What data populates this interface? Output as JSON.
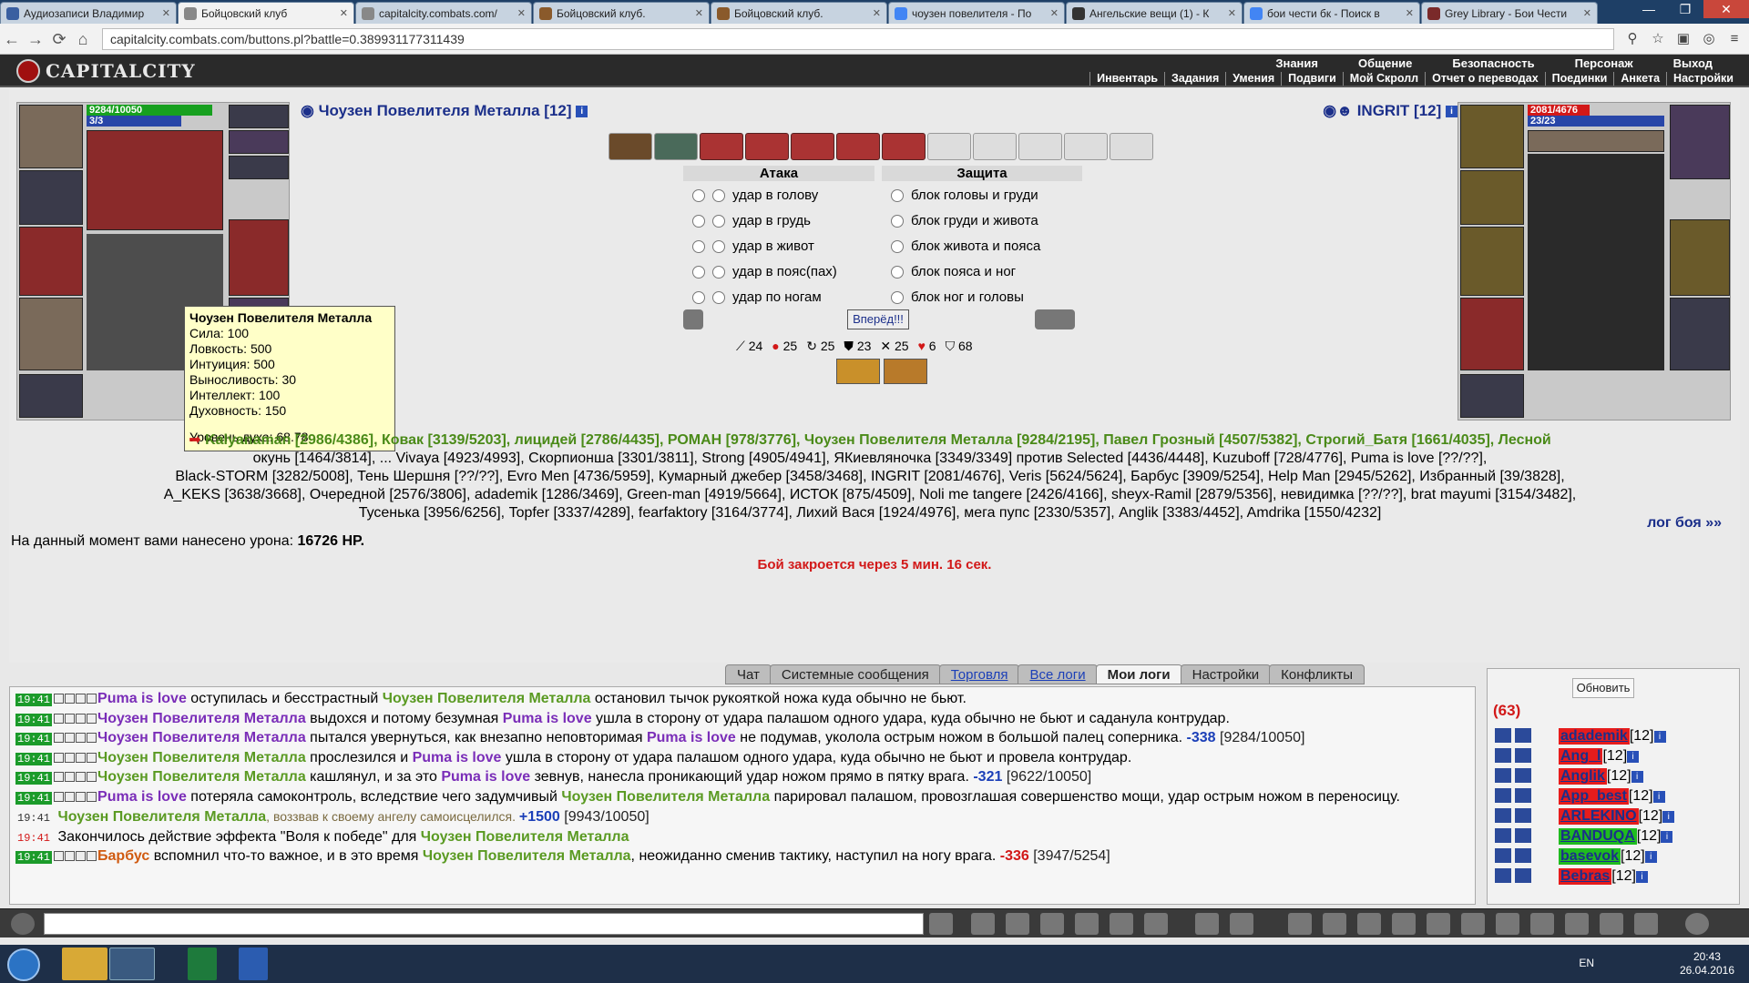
{
  "browser": {
    "tabs": [
      "Аудиозаписи Владимир",
      "Бойцовский клуб",
      "capitalcity.combats.com/",
      "Бойцовский клуб.",
      "Бойцовский клуб.",
      "чоузен повелителя - По",
      "Ангельские вещи (1) - К",
      "бои чести бк - Поиск в",
      "Grey Library - Бои Чести"
    ],
    "url": "capitalcity.combats.com/buttons.pl?battle=0.389931177311439"
  },
  "game": {
    "logo": "CAPITALCITY",
    "top_menu": [
      "Знания",
      "Общение",
      "Безопасность",
      "Персонаж",
      "Выход"
    ],
    "sub_menu": [
      "Инвентарь",
      "Задания",
      "Умения",
      "Подвиги",
      "Мой Скролл",
      "Отчет о переводах",
      "Поединки",
      "Анкета",
      "Настройки"
    ]
  },
  "player": {
    "name": "Чоузен Повелителя Металла [12]",
    "hp": "9284/10050",
    "mana": "3/3",
    "hp_fraction": 0.92,
    "tooltip": {
      "name": "Чоузен Повелителя Металла",
      "lines": [
        "Сила: 100",
        "Ловкость: 500",
        "Интуиция: 500",
        "Выносливость: 30",
        "Интеллект: 100",
        "Духовность: 150"
      ],
      "spirit": "Уровень духа: 68.78"
    }
  },
  "enemy": {
    "name": "INGRIT [12]",
    "hp": "2081/4676",
    "mana": "23/23",
    "hp_fraction": 0.45
  },
  "combat": {
    "attack_title": "Атака",
    "defense_title": "Защита",
    "attacks": [
      "удар в голову",
      "удар в грудь",
      "удар в живот",
      "удар в пояс(пах)",
      "удар по ногам"
    ],
    "defenses": [
      "блок головы и груди",
      "блок груди и живота",
      "блок живота и пояса",
      "блок пояса и ног",
      "блок ног и головы"
    ],
    "forward_button": "Вперёд!!!",
    "stats": [
      "24",
      "25",
      "25",
      "23",
      "25",
      "6",
      "68"
    ]
  },
  "fighters": {
    "line1": "Kalyanaman [2986/4386], Ковак [3139/5203], лицидей [2786/4435], РОМАН [978/3776], Чоузен Повелителя Металла [9284/2195], Павел Грозный [4507/5382], Строгий_Батя [1661/4035], Лесной",
    "line2": "окунь [1464/3814], ... Vivaya [4923/4993], Скорпионша [3301/3811], Strong [4905/4941], ЯКиевляночка [3349/3349]  против  Selected [4436/4448], Kuzuboff [728/4776], Puma is love [??/??],",
    "line3": "Black-STORM [3282/5008], Тень Шершня [??/??], Evro Men [4736/5959], Кумарный джебер [3458/3468], INGRIT [2081/4676], Veris [5624/5624], Барбус [3909/5254], Help Man [2945/5262], Избранный [39/3828],",
    "line4": "A_KEKS [3638/3668], Очередной [2576/3806], adademik [1286/3469], Green-man [4919/5664], ИСТОК [875/4509], Noli me tangere [2426/4166], sheyx-Ramil [2879/5356], невидимка [??/??], brat mayumi [3154/3482],",
    "line5": "Тусенька [3956/6256], Topfer [3337/4289], fearfaktory [3164/3774], Лихий Вася [1924/4976], мега пупс [2330/5357], Anglik [3383/4452], Amdrika [1550/4232]"
  },
  "damage": {
    "prefix": "На данный момент вами нанесено урона:",
    "value": "16726 HP."
  },
  "battle_log_link": "лог боя »»",
  "close_message": "Бой закроется через 5 мин. 16 сек.",
  "chat": {
    "tabs": [
      "Чат",
      "Системные сообщения",
      "Торговля",
      "Все логи",
      "Мои логи",
      "Настройки",
      "Конфликты"
    ],
    "lines": [
      {
        "time": "19:41",
        "a": "Puma is love",
        "t1": " оступилась и бесстрастный ",
        "b": "Чоузен Повелителя Металла",
        "t2": " остановил тычок рукояткой ножа куда обычно не бьют."
      },
      {
        "time": "19:41",
        "a": "Чоузен Повелителя Металла",
        "t1": " выдохся и потому безумная ",
        "b": "Puma is love",
        "t2": " ушла в сторону от удара палашом одного удара, куда обычно не бьют и саданула контрудар."
      },
      {
        "time": "19:41",
        "a": "Чоузен Повелителя Металла",
        "t1": " пытался увернуться, как внезапно неповторимая ",
        "b": "Puma is love",
        "t2": " не подумав, уколола острым ножом в большой палец соперника. ",
        "dmg": "-338",
        "hp": " [9284/10050]"
      },
      {
        "time": "19:41",
        "a": "Чоузен Повелителя Металла",
        "t1": " прослезился и ",
        "b": "Puma is love",
        "t2": " ушла в сторону от удара палашом одного удара, куда обычно не бьют и провела контрудар."
      },
      {
        "time": "19:41",
        "a": "Чоузен Повелителя Металла",
        "t1": " кашлянул, и за это ",
        "b": "Puma is love",
        "t2": " зевнув, нанесла проникающий удар ножом прямо в пятку врага. ",
        "dmg": "-321",
        "hp": " [9622/10050]"
      },
      {
        "time": "19:41",
        "a": "Puma is love",
        "t1": " потеряла самоконтроль, вследствие чего задумчивый ",
        "b": "Чоузен Повелителя Металла",
        "t2": " парировал палашом, провозглашая совершенство мощи, удар острым ножом в переносицу."
      },
      {
        "time": "19:41",
        "a": "Чоузен Повелителя Металла",
        "t1": ", воззвав к своему ангелу самоисцелился. ",
        "heal": "+1500",
        "hp": " [9943/10050]"
      },
      {
        "time": "19:41",
        "plain": "Закончилось действие эффекта \"Воля к победе\" для ",
        "b": "Чоузен Повелителя Металла"
      },
      {
        "time": "19:41",
        "a": "Барбус",
        "t1": " вспомнил что-то важное, и в это время ",
        "b": "Чоузен Повелителя Металла",
        "t2": ", неожиданно сменив тактику, наступил на ногу врага. ",
        "dmg": "-336",
        "hp": " [3947/5254]"
      }
    ]
  },
  "users": {
    "refresh": "Обновить",
    "count": "(63)",
    "list": [
      {
        "name": "adademik",
        "lvl": "[12]",
        "bg": "red"
      },
      {
        "name": "Ang_l",
        "lvl": "[12]",
        "bg": "red"
      },
      {
        "name": "Anglik",
        "lvl": "[12]",
        "bg": "red"
      },
      {
        "name": "App_best",
        "lvl": "[12]",
        "bg": "red"
      },
      {
        "name": "ARLEKINO",
        "lvl": "[12]",
        "bg": "red"
      },
      {
        "name": "BANDUQA",
        "lvl": "[12]",
        "bg": "green"
      },
      {
        "name": "basevok",
        "lvl": "[12]",
        "bg": "green"
      },
      {
        "name": "Bebras",
        "lvl": "[12]",
        "bg": "red"
      }
    ]
  },
  "taskbar": {
    "lang": "EN",
    "time": "20:43",
    "date": "26.04.2016"
  },
  "colors": {
    "accent": "#1b2f8a",
    "damage": "#d21818",
    "hp": "#17a01f",
    "mana": "#2846a8"
  }
}
